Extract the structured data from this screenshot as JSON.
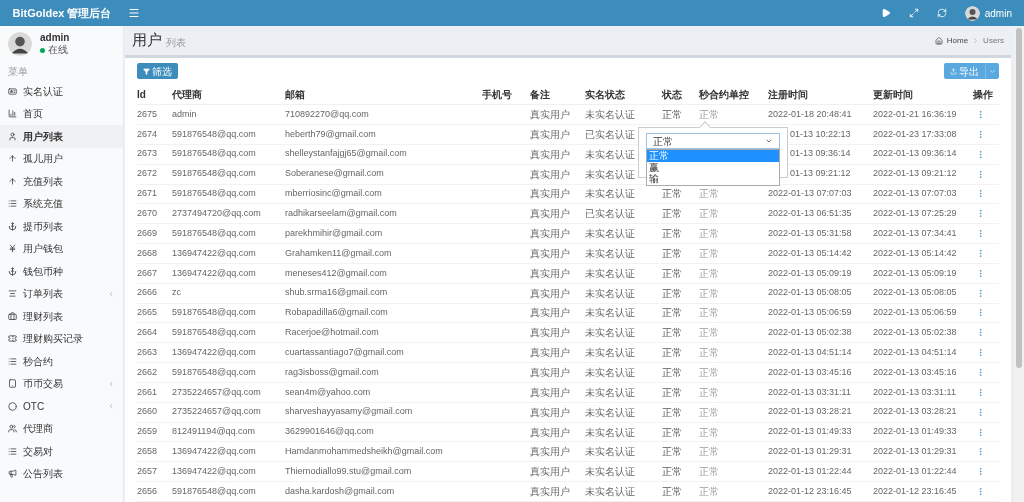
{
  "app": {
    "title": "BitGoldex 管理后台"
  },
  "top_bar": {
    "user": "admin"
  },
  "sidebar": {
    "user": {
      "name": "admin",
      "status": "在线"
    },
    "menu_label": "菜单",
    "items": [
      {
        "label": "实名认证",
        "selected": false,
        "has_children": false
      },
      {
        "label": "首页",
        "selected": false,
        "has_children": false
      },
      {
        "label": "用户列表",
        "selected": true,
        "has_children": false
      },
      {
        "label": "孤儿用户",
        "selected": false,
        "has_children": false
      },
      {
        "label": "充值列表",
        "selected": false,
        "has_children": false
      },
      {
        "label": "系统充值",
        "selected": false,
        "has_children": false
      },
      {
        "label": "提币列表",
        "selected": false,
        "has_children": false
      },
      {
        "label": "用户钱包",
        "selected": false,
        "has_children": false
      },
      {
        "label": "钱包币种",
        "selected": false,
        "has_children": false
      },
      {
        "label": "订单列表",
        "selected": false,
        "has_children": true
      },
      {
        "label": "理财列表",
        "selected": false,
        "has_children": false
      },
      {
        "label": "理财购买记录",
        "selected": false,
        "has_children": false
      },
      {
        "label": "秒合约",
        "selected": false,
        "has_children": false
      },
      {
        "label": "币币交易",
        "selected": false,
        "has_children": true
      },
      {
        "label": "OTC",
        "selected": false,
        "has_children": true
      },
      {
        "label": "代理商",
        "selected": false,
        "has_children": false
      },
      {
        "label": "交易对",
        "selected": false,
        "has_children": false
      },
      {
        "label": "公告列表",
        "selected": false,
        "has_children": false
      }
    ]
  },
  "page": {
    "title": "用户",
    "subtitle": "列表",
    "breadcrumb": [
      "Home",
      "Users"
    ]
  },
  "toolbar": {
    "filter": "筛选",
    "export": "导出"
  },
  "table": {
    "columns": [
      "Id",
      "代理商",
      "邮箱",
      "手机号",
      "备注",
      "实名状态",
      "状态",
      "秒合约单控",
      "注册时间",
      "更新时间",
      "操作"
    ],
    "rows": [
      {
        "id": "2675",
        "agent": "admin",
        "email": "710892270@qq.com",
        "note": "真实用户",
        "verification": "未实名认证",
        "status": "正常",
        "control": "正常",
        "registered": "2022-01-18 20:48:41",
        "updated": "2022-01-21 16:36:19",
        "covered": false
      },
      {
        "id": "2674",
        "agent": "591876548@qq.com",
        "email": "heberth79@gmail.com",
        "note": "真实用户",
        "verification": "已实名认证",
        "registered": "01-13 10:22:13",
        "updated": "2022-01-23 17:33:08",
        "covered": true
      },
      {
        "id": "2673",
        "agent": "591876548@qq.com",
        "email": "shelleystanfajgj65@gmail.com",
        "note": "真实用户",
        "verification": "未实名认证",
        "registered": "01-13 09:36:14",
        "updated": "2022-01-13 09:36:14",
        "covered": true
      },
      {
        "id": "2672",
        "agent": "591876548@qq.com",
        "email": "Soberanese@gmail.com",
        "note": "真实用户",
        "verification": "未实名认证",
        "registered": "01-13 09:21:12",
        "updated": "2022-01-13 09:21:12",
        "covered": true
      },
      {
        "id": "2671",
        "agent": "591876548@qq.com",
        "email": "mberriosinc@gmail.com",
        "note": "真实用户",
        "verification": "未实名认证",
        "status": "正常",
        "control": "正常",
        "registered": "2022-01-13 07:07:03",
        "updated": "2022-01-13 07:07:03",
        "covered": false
      },
      {
        "id": "2670",
        "agent": "2737494720@qq.com",
        "email": "radhikarseelam@gmail.com",
        "note": "真实用户",
        "verification": "已实名认证",
        "status": "正常",
        "control": "正常",
        "registered": "2022-01-13 06:51:35",
        "updated": "2022-01-13 07:25:29",
        "covered": false
      },
      {
        "id": "2669",
        "agent": "591876548@qq.com",
        "email": "parekhmihir@gmail.com",
        "note": "真实用户",
        "verification": "未实名认证",
        "status": "正常",
        "control": "正常",
        "registered": "2022-01-13 05:31:58",
        "updated": "2022-01-13 07:34:41",
        "covered": false
      },
      {
        "id": "2668",
        "agent": "136947422@qq.com",
        "email": "Grahamken11@gmail.com",
        "note": "真实用户",
        "verification": "未实名认证",
        "status": "正常",
        "control": "正常",
        "registered": "2022-01-13 05:14:42",
        "updated": "2022-01-13 05:14:42",
        "covered": false
      },
      {
        "id": "2667",
        "agent": "136947422@qq.com",
        "email": "meneses412@gmail.com",
        "note": "真实用户",
        "verification": "未实名认证",
        "status": "正常",
        "control": "正常",
        "registered": "2022-01-13 05:09:19",
        "updated": "2022-01-13 05:09:19",
        "covered": false
      },
      {
        "id": "2666",
        "agent": "zc",
        "email": "shub.srma16@gmail.com",
        "note": "真实用户",
        "verification": "未实名认证",
        "status": "正常",
        "control": "正常",
        "registered": "2022-01-13 05:08:05",
        "updated": "2022-01-13 05:08:05",
        "covered": false
      },
      {
        "id": "2665",
        "agent": "591876548@qq.com",
        "email": "Robapadilla6@gmail.com",
        "note": "真实用户",
        "verification": "未实名认证",
        "status": "正常",
        "control": "正常",
        "registered": "2022-01-13 05:06:59",
        "updated": "2022-01-13 05:06:59",
        "covered": false
      },
      {
        "id": "2664",
        "agent": "591876548@qq.com",
        "email": "Racerjoe@hotmail.com",
        "note": "真实用户",
        "verification": "未实名认证",
        "status": "正常",
        "control": "正常",
        "registered": "2022-01-13 05:02:38",
        "updated": "2022-01-13 05:02:38",
        "covered": false
      },
      {
        "id": "2663",
        "agent": "136947422@qq.com",
        "email": "cuartassantiago7@gmail.com",
        "note": "真实用户",
        "verification": "未实名认证",
        "status": "正常",
        "control": "正常",
        "registered": "2022-01-13 04:51:14",
        "updated": "2022-01-13 04:51:14",
        "covered": false
      },
      {
        "id": "2662",
        "agent": "591876548@qq.com",
        "email": "rag3isboss@gmail.com",
        "note": "真实用户",
        "verification": "未实名认证",
        "status": "正常",
        "control": "正常",
        "registered": "2022-01-13 03:45:16",
        "updated": "2022-01-13 03:45:16",
        "covered": false
      },
      {
        "id": "2661",
        "agent": "2735224657@qq.com",
        "email": "sean4m@yahoo.com",
        "note": "真实用户",
        "verification": "未实名认证",
        "status": "正常",
        "control": "正常",
        "registered": "2022-01-13 03:31:11",
        "updated": "2022-01-13 03:31:11",
        "covered": false
      },
      {
        "id": "2660",
        "agent": "2735224657@qq.com",
        "email": "sharveshayyasamy@gmail.com",
        "note": "真实用户",
        "verification": "未实名认证",
        "status": "正常",
        "control": "正常",
        "registered": "2022-01-13 03:28:21",
        "updated": "2022-01-13 03:28:21",
        "covered": false
      },
      {
        "id": "2659",
        "agent": "812491194@qq.com",
        "email": "3629901646@qq.com",
        "note": "真实用户",
        "verification": "未实名认证",
        "status": "正常",
        "control": "正常",
        "registered": "2022-01-13 01:49:33",
        "updated": "2022-01-13 01:49:33",
        "covered": false
      },
      {
        "id": "2658",
        "agent": "136947422@qq.com",
        "email": "Hamdanmohammedsheikh@gmail.com",
        "note": "真实用户",
        "verification": "未实名认证",
        "status": "正常",
        "control": "正常",
        "registered": "2022-01-13 01:29:31",
        "updated": "2022-01-13 01:29:31",
        "covered": false
      },
      {
        "id": "2657",
        "agent": "136947422@qq.com",
        "email": "Thiernodiallo99.stu@gmail.com",
        "note": "真实用户",
        "verification": "未实名认证",
        "status": "正常",
        "control": "正常",
        "registered": "2022-01-13 01:22:44",
        "updated": "2022-01-13 01:22:44",
        "covered": false
      },
      {
        "id": "2656",
        "agent": "591876548@qq.com",
        "email": "dasha.kardosh@gmail.com",
        "note": "真实用户",
        "verification": "未实名认证",
        "status": "正常",
        "control": "正常",
        "registered": "2022-01-12 23:16:45",
        "updated": "2022-01-12 23:16:45",
        "covered": false
      }
    ]
  },
  "popover": {
    "value": "正常",
    "options": [
      {
        "label": "正常",
        "selected": true
      },
      {
        "label": "赢",
        "selected": false
      },
      {
        "label": "输",
        "selected": false
      }
    ]
  }
}
